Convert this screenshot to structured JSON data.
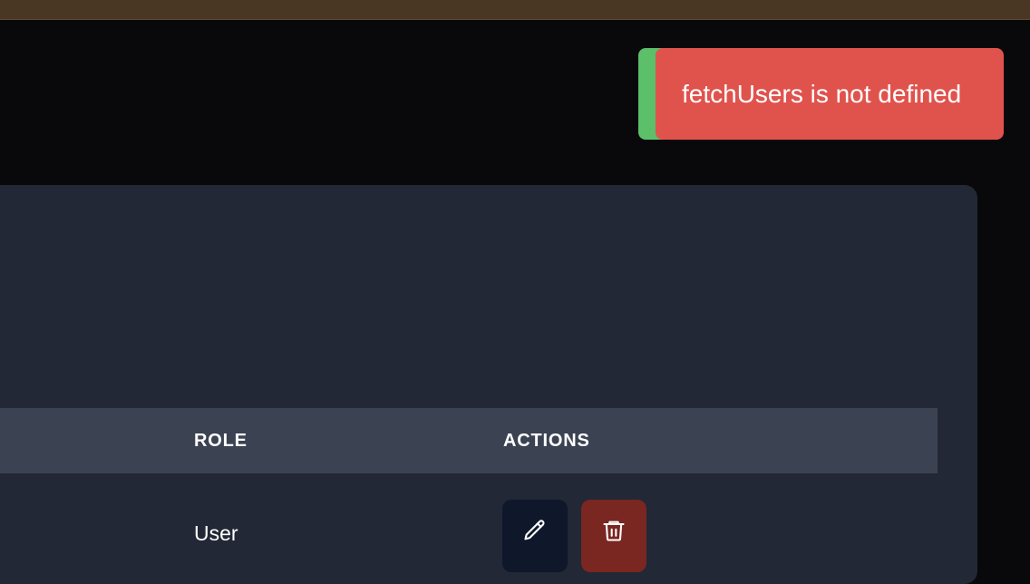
{
  "toast": {
    "message": "fetchUsers is not defined",
    "color": "#e0534d",
    "accent_color": "#5cbf6a"
  },
  "table": {
    "columns": [
      "ROLE",
      "ACTIONS"
    ],
    "rows": [
      {
        "role": "User",
        "actions": [
          "pencil-icon",
          "trash-icon"
        ]
      }
    ]
  },
  "colors": {
    "background": "#09090b",
    "top_bar": "#4a3723",
    "card": "#222836",
    "table_header": "#3b4252",
    "edit_button": "#0f172a",
    "delete_button": "#7a2621"
  }
}
